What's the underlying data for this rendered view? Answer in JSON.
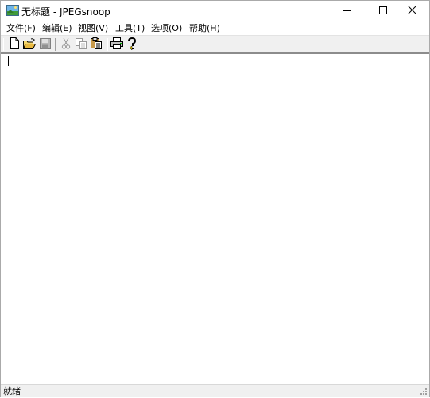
{
  "window": {
    "title": "无标题 - JPEGsnoop",
    "app_icon": "picture-icon",
    "controls": [
      "minimize-icon",
      "maximize-icon",
      "close-icon"
    ]
  },
  "menu": {
    "items": [
      {
        "label": "文件(F)"
      },
      {
        "label": "编辑(E)"
      },
      {
        "label": "视图(V)"
      },
      {
        "label": "工具(T)"
      },
      {
        "label": "选项(O)"
      },
      {
        "label": "帮助(H)"
      }
    ]
  },
  "toolbar": {
    "buttons": [
      {
        "icon": "new-document-icon",
        "enabled": true
      },
      {
        "icon": "open-folder-icon",
        "enabled": true
      },
      {
        "icon": "save-icon",
        "enabled": false
      },
      {
        "icon": "cut-icon",
        "enabled": false
      },
      {
        "icon": "copy-icon",
        "enabled": false
      },
      {
        "icon": "paste-icon",
        "enabled": true
      },
      {
        "icon": "print-icon",
        "enabled": true
      },
      {
        "icon": "help-icon",
        "enabled": true
      }
    ]
  },
  "status": {
    "text": "就绪"
  },
  "colors": {
    "chrome": "#f0f0f0",
    "border": "#aaaaaa"
  }
}
